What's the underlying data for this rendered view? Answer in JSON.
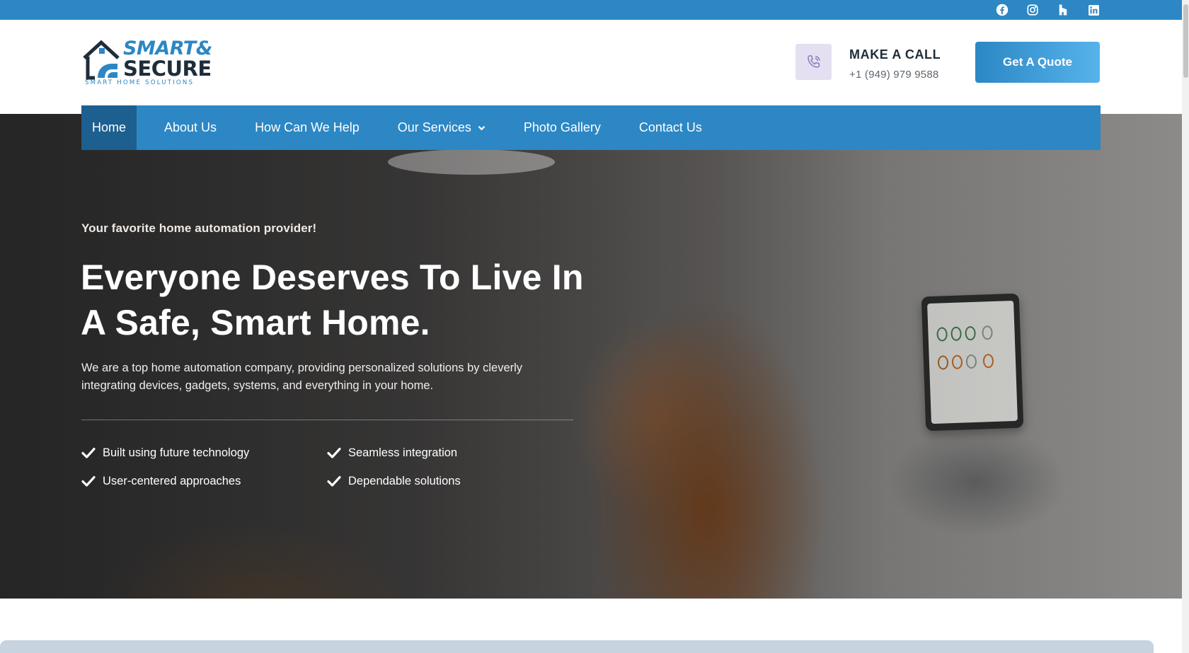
{
  "social": {
    "items": [
      {
        "name": "facebook-icon"
      },
      {
        "name": "instagram-icon"
      },
      {
        "name": "houzz-icon"
      },
      {
        "name": "linkedin-icon"
      }
    ]
  },
  "brand": {
    "line1": "SMART&",
    "line2": "SECURE",
    "tagline": "SMART HOME SOLUTIONS",
    "colors": {
      "primary": "#2c87c4",
      "dark": "#1f2d3a",
      "active_nav": "#1d5f8f"
    }
  },
  "header": {
    "call_title": "MAKE A CALL",
    "call_phone": "+1 (949) 979 9588",
    "quote_label": "Get A Quote"
  },
  "nav": {
    "items": [
      {
        "label": "Home",
        "active": true
      },
      {
        "label": "About Us"
      },
      {
        "label": "How Can We Help"
      },
      {
        "label": "Our Services",
        "has_dropdown": true
      },
      {
        "label": "Photo Gallery"
      },
      {
        "label": "Contact Us"
      }
    ]
  },
  "hero": {
    "subtitle": "Your favorite home automation provider!",
    "headline_line1": "Everyone Deserves To Live In",
    "headline_line2": "A Safe, Smart Home.",
    "description": "We are a top home automation company, providing personalized solutions by cleverly integrating devices, gadgets, systems, and everything in your home.",
    "features": [
      "Built using future technology",
      "User-centered approaches",
      "Seamless integration",
      "Dependable solutions"
    ]
  }
}
